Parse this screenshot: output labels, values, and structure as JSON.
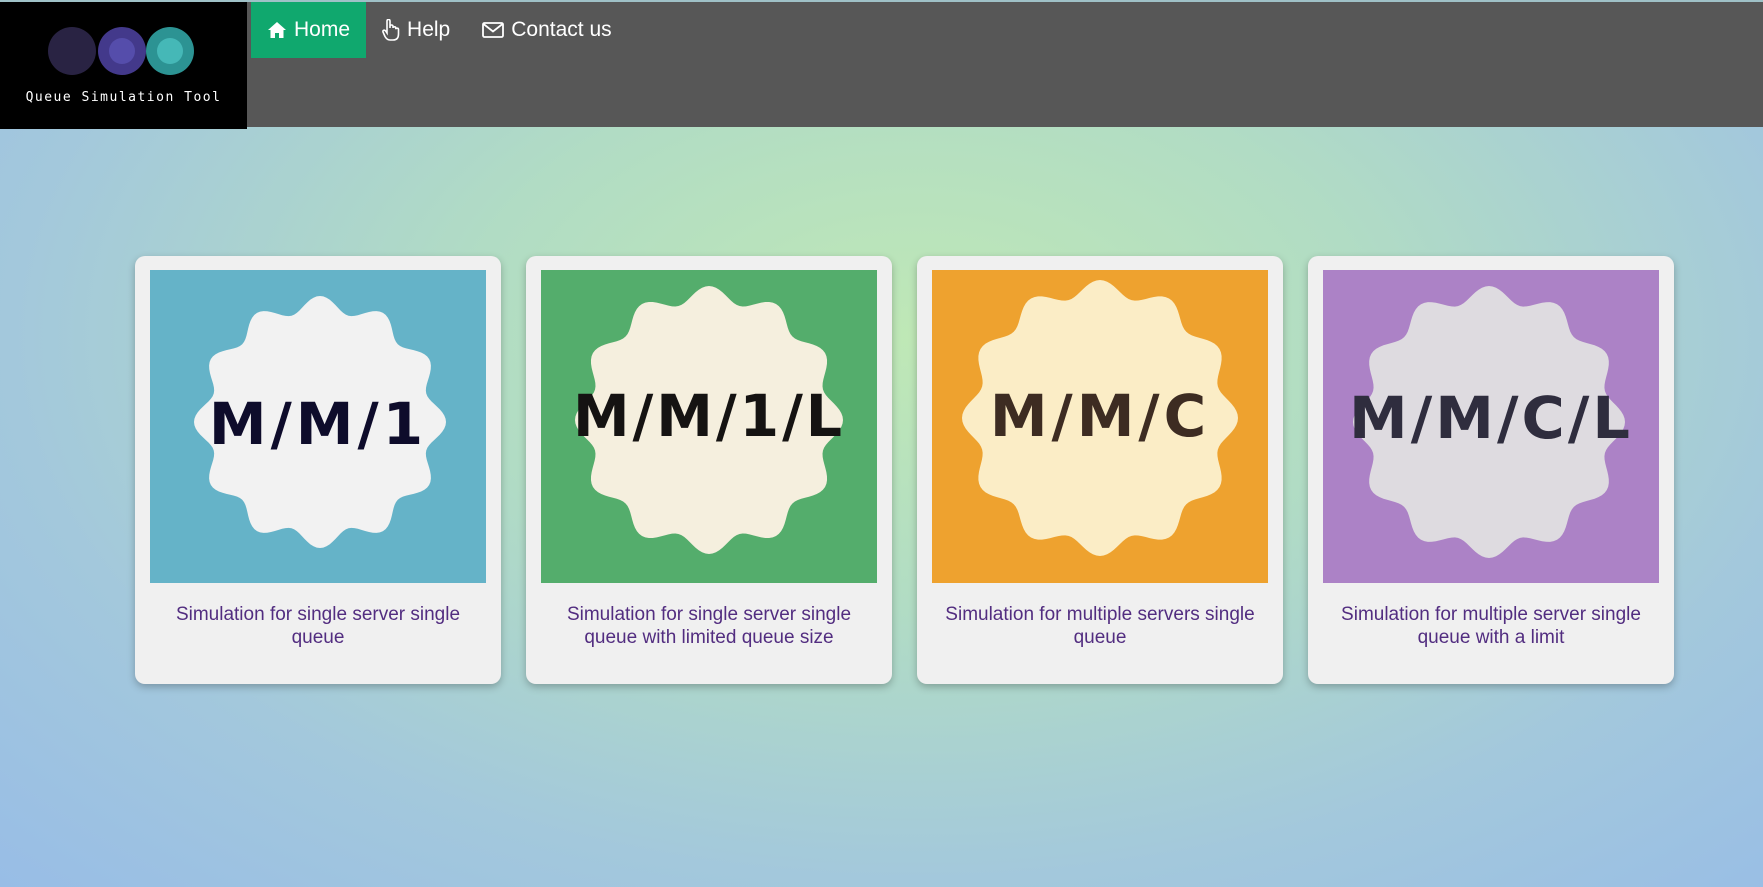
{
  "header": {
    "logo_text": "Queue Simulation Tool",
    "nav": [
      {
        "label": "Home",
        "icon": "home-icon",
        "active": true
      },
      {
        "label": "Help",
        "icon": "pointer-hand-icon",
        "active": false
      },
      {
        "label": "Contact us",
        "icon": "envelope-icon",
        "active": false
      }
    ]
  },
  "cards": [
    {
      "badge": "M/M/1",
      "description": "Simulation for single server single queue",
      "bg": "#65b3c8",
      "badge_bg": "#f2f2f2",
      "text_color": "#0e0c2b"
    },
    {
      "badge": "M/M/1/L",
      "description": "Simulation for single server single queue with limited queue size",
      "bg": "#54ad6c",
      "badge_bg": "#f5efde",
      "text_color": "#151312"
    },
    {
      "badge": "M/M/C",
      "description": "Simulation for multiple servers single queue",
      "bg": "#eea22f",
      "badge_bg": "#fbedc6",
      "text_color": "#3d2c22"
    },
    {
      "badge": "M/M/C/L",
      "description": "Simulation for multiple server single queue with a limit",
      "bg": "#ac82c6",
      "badge_bg": "#dedbe0",
      "text_color": "#2f2d3e"
    }
  ]
}
